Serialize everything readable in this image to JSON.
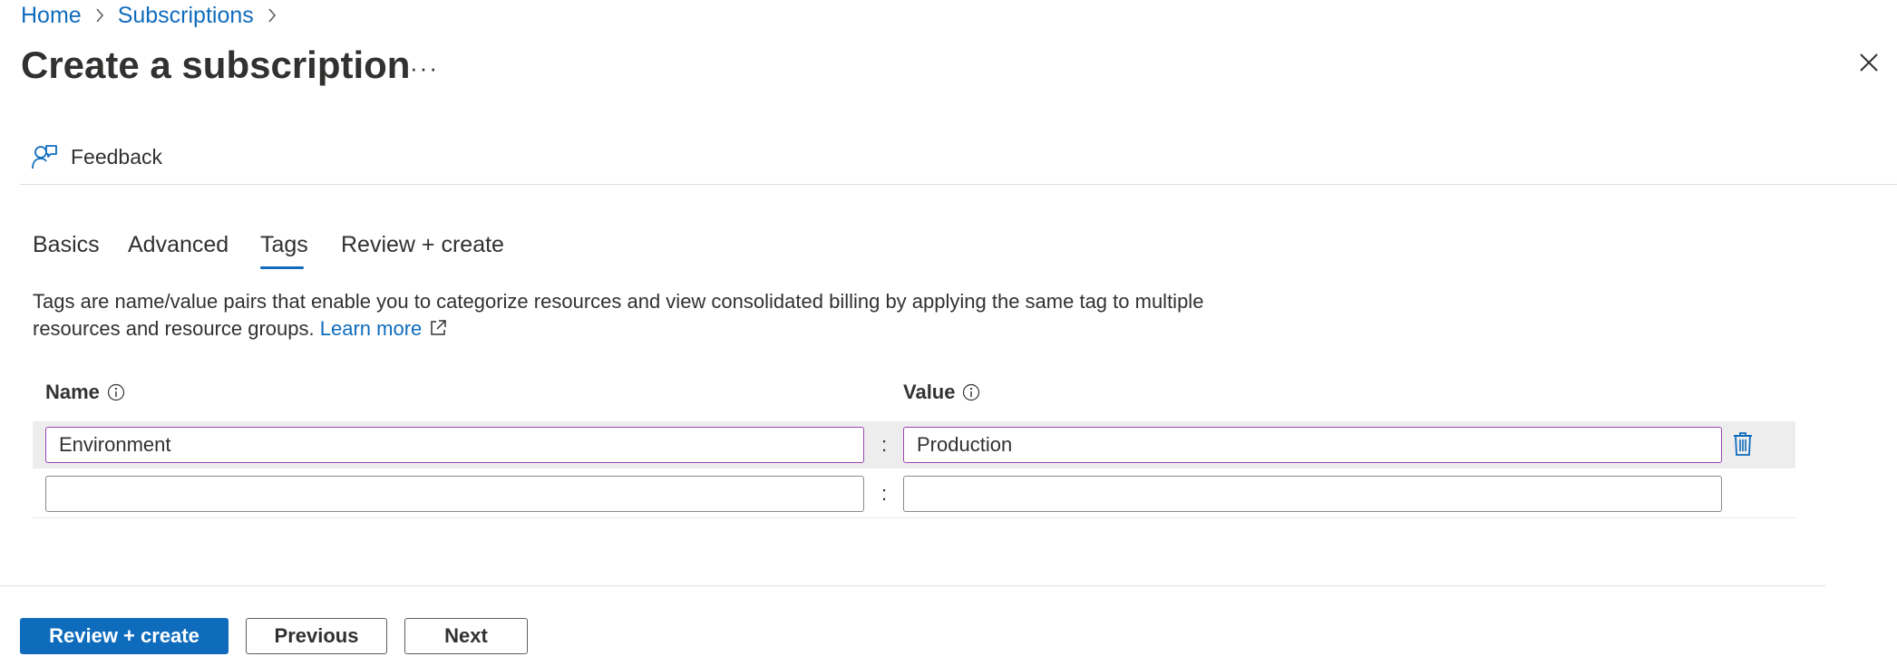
{
  "breadcrumb": {
    "home": "Home",
    "subscriptions": "Subscriptions"
  },
  "page": {
    "title": "Create a subscription",
    "more": "···"
  },
  "commandbar": {
    "feedback": "Feedback"
  },
  "tabs": [
    {
      "label": "Basics"
    },
    {
      "label": "Advanced"
    },
    {
      "label": "Tags",
      "active": true
    },
    {
      "label": "Review + create"
    }
  ],
  "description": {
    "text": "Tags are name/value pairs that enable you to categorize resources and view consolidated billing by applying the same tag to multiple resources and resource groups.",
    "learn_more": "Learn more"
  },
  "table": {
    "name_header": "Name",
    "value_header": "Value",
    "separator": ":",
    "rows": [
      {
        "name": "Environment",
        "value": "Production"
      },
      {
        "name": "",
        "value": ""
      }
    ]
  },
  "footer": {
    "review_create": "Review + create",
    "previous": "Previous",
    "next": "Next"
  },
  "colors": {
    "accent": "#0f6cbd",
    "input_border_active": "#9b44b8"
  },
  "icons": [
    "chevron-right-icon",
    "more-icon",
    "close-icon",
    "feedback-icon",
    "info-icon",
    "external-link-icon",
    "delete-icon"
  ]
}
